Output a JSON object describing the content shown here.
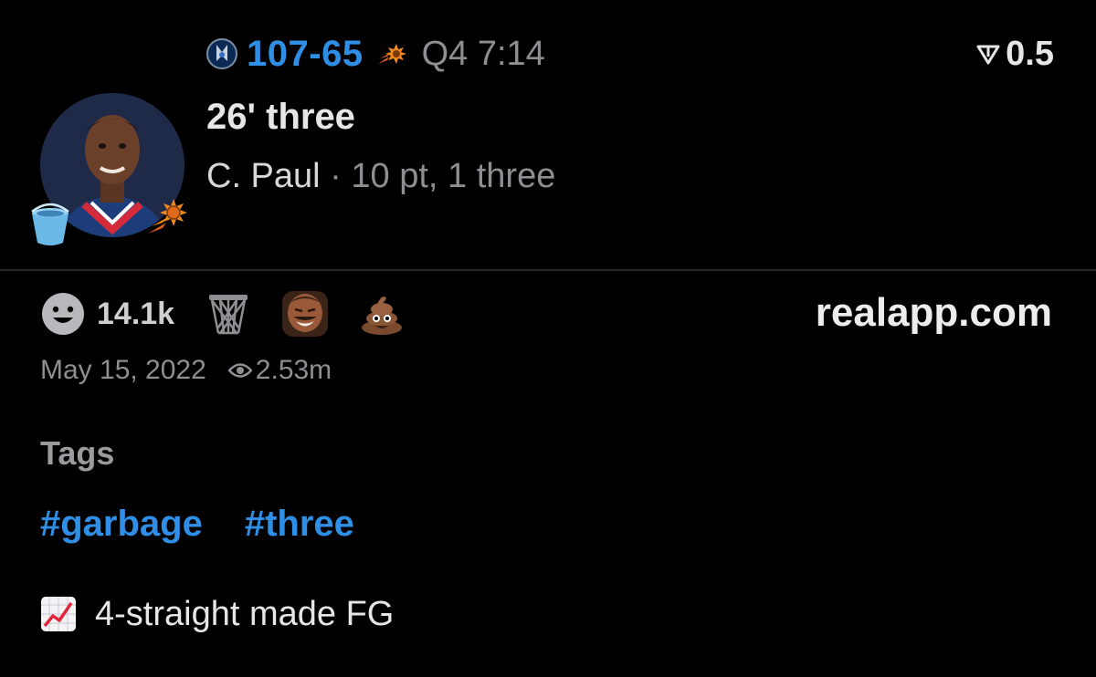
{
  "game": {
    "away_team_icon": "mavericks-logo-icon",
    "score_away": "107",
    "score_sep": "-",
    "score_home": "65",
    "home_team_icon": "suns-logo-icon",
    "clock": "Q4 7:14"
  },
  "odds": {
    "icon": "down-triangle-icon",
    "value": "0.5"
  },
  "play": {
    "title": "26' three",
    "player": "C. Paul",
    "separator": " · ",
    "stats": "10 pt, 1 three"
  },
  "avatar": {
    "badge_left": "bucket-icon",
    "badge_right": "suns-logo-icon"
  },
  "reactions": {
    "count": "14.1k",
    "icons": [
      "smile-icon",
      "basketball-net-icon",
      "laughing-man-icon",
      "poop-emoji-icon"
    ]
  },
  "source": {
    "site": "realapp.com"
  },
  "meta": {
    "date": "May 15, 2022",
    "views": "2.53m"
  },
  "tags": {
    "title": "Tags",
    "items": [
      "#garbage",
      "#three"
    ]
  },
  "streak": {
    "icon": "chart-increasing-icon",
    "text": "4-straight made FG"
  },
  "colors": {
    "accent": "#2f8fe6",
    "muted": "#8e8e93",
    "background": "#000000"
  }
}
